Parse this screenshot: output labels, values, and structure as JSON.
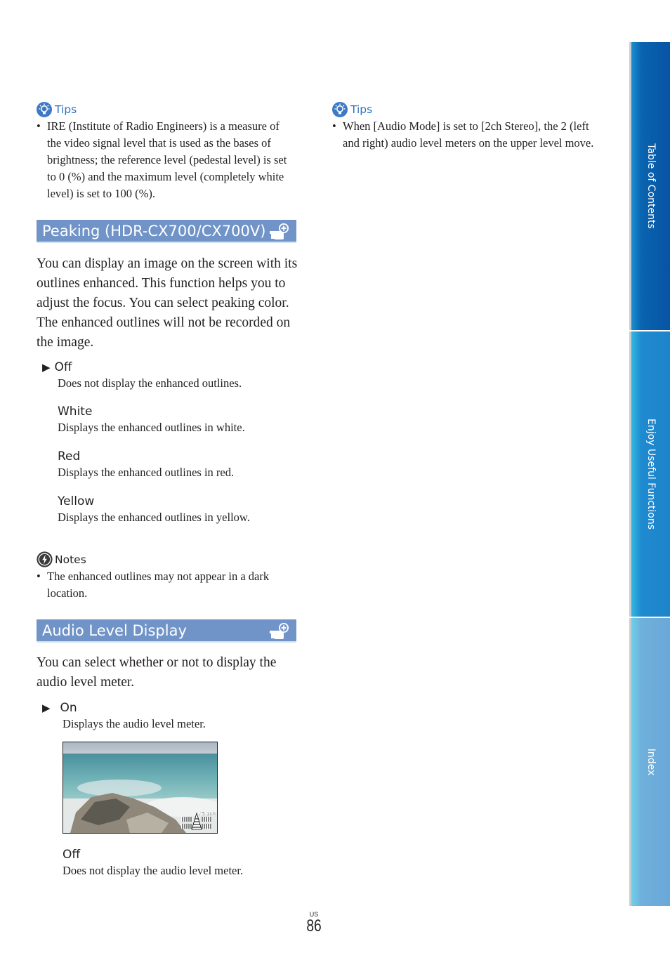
{
  "left_tips": {
    "header": "Tips",
    "items": [
      "IRE (Institute of Radio Engineers) is a measure of the video signal level that is used as the bases of brightness; the reference level (pedestal level) is set to 0 (%) and the maximum level (completely white level) is set to 100 (%)."
    ]
  },
  "right_tips": {
    "header": "Tips",
    "items": [
      "When [Audio Mode] is set to [2ch Stereo], the 2 (left and right) audio level meters on the upper level move."
    ]
  },
  "peaking": {
    "title": "Peaking (HDR-CX700/CX700V)",
    "icon": "menu-plus-icon",
    "intro": "You can display an image on the screen with its outlines enhanced. This function helps you to adjust the focus. You can select peaking color. The enhanced outlines will not be recorded on the image.",
    "options": [
      {
        "label": "Off",
        "desc": "Does not display the enhanced outlines.",
        "default": true
      },
      {
        "label": "White",
        "desc": "Displays the enhanced outlines in white.",
        "default": false
      },
      {
        "label": "Red",
        "desc": "Displays the enhanced outlines in red.",
        "default": false
      },
      {
        "label": "Yellow",
        "desc": "Displays the enhanced outlines in yellow.",
        "default": false
      }
    ],
    "default_marker": "▶"
  },
  "notes": {
    "header": "Notes",
    "items": [
      "The enhanced outlines may not appear in a dark location."
    ]
  },
  "audio_level": {
    "title": "Audio Level Display",
    "icon": "menu-plus-icon",
    "intro": "You can select whether or not to display the audio level meter.",
    "options": [
      {
        "label": "On",
        "desc": "Displays the audio level meter.",
        "default": true
      },
      {
        "label": "Off",
        "desc": "Does not display the audio level meter.",
        "default": false
      }
    ],
    "default_marker": "▶",
    "screen_overlay_text": "♪5.1ch"
  },
  "side_tabs": [
    {
      "label": "Table of Contents"
    },
    {
      "label": "Enjoy Useful Functions"
    },
    {
      "label": "Index"
    }
  ],
  "footer": {
    "region": "US",
    "page_number": "86"
  },
  "colors": {
    "section_bar": "#7093c8",
    "tips_blue": "#2e74c0",
    "tab_toc": "#0754a3",
    "tab_functions": "#1e84c9",
    "tab_index": "#6aa8d8"
  }
}
